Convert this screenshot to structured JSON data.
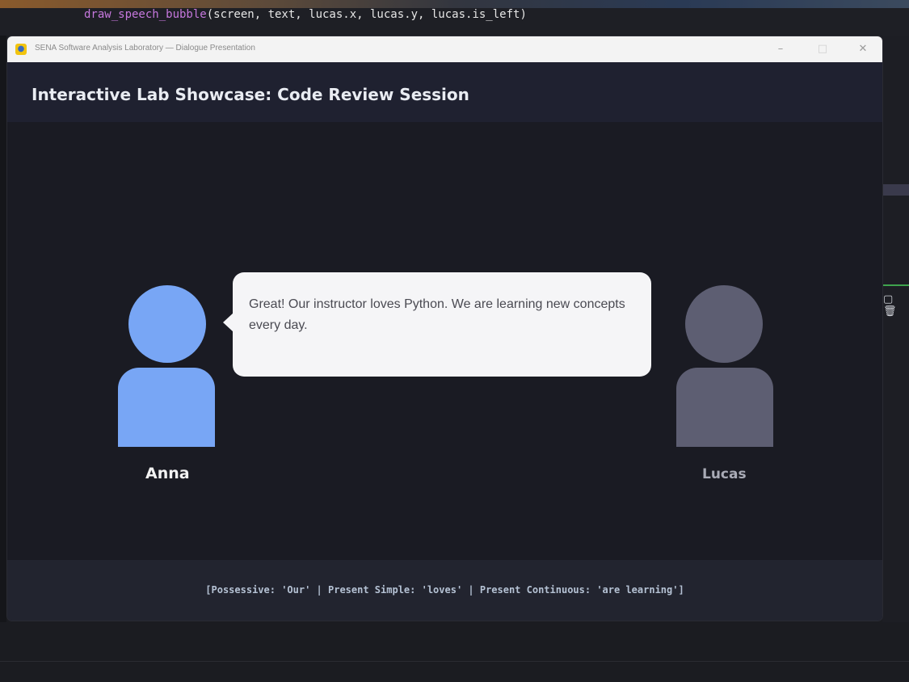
{
  "background_editor": {
    "code_function": "draw_speech_bubble",
    "code_args": "(screen, text, lucas.x, lucas.y, lucas.is_left)"
  },
  "window": {
    "title": "SENA Software Analysis Laboratory — Dialogue Presentation",
    "app_icon": "python-icon",
    "minimize": "–",
    "maximize": "□",
    "close": "✕"
  },
  "header": {
    "title": "Interactive Lab Showcase: Code Review Session"
  },
  "characters": {
    "anna": {
      "name": "Anna",
      "color": "#78a6f5",
      "active": true
    },
    "lucas": {
      "name": "Lucas",
      "color": "#5d5e72",
      "active": false
    }
  },
  "speech_bubble": {
    "speaker": "Anna",
    "text": "Great! Our instructor loves Python. We are learning new concepts every day."
  },
  "footer": {
    "grammar_note": "[Possessive: 'Our' | Present Simple: 'loves' | Present Continuous: 'are learning']"
  },
  "colors": {
    "window_bg": "#1a1b23",
    "header_bg": "#1f2130",
    "bubble_bg": "#f5f5f7",
    "footer_text": "#b5c2d4"
  }
}
